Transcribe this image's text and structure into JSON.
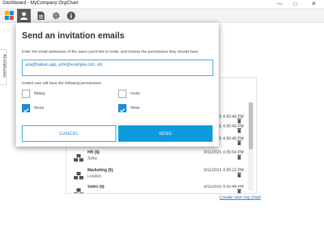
{
  "window": {
    "title": "Dashboard - MyCompany OrgChart",
    "controls": [
      "minimize-icon",
      "maximize-icon",
      "close-icon"
    ]
  },
  "toolbar": {
    "items": [
      {
        "icon": "app-logo-icon"
      },
      {
        "icon": "user-icon",
        "active": true
      },
      {
        "icon": "document-icon"
      },
      {
        "icon": "gear-icon"
      },
      {
        "icon": "info-icon"
      }
    ]
  },
  "sidetab": {
    "label": "All employees"
  },
  "dialog": {
    "title": "Send an invitation emails",
    "instructions": "Enter the email addresses of the users you'd like to invite, and choose the permissions they should have",
    "emails_placeholder": "ana@balkan.app, john@example.com, etc",
    "permissions_label": "Invited user will have the following permissions",
    "permissions": [
      {
        "label": "Billing",
        "checked": false
      },
      {
        "label": "Invite",
        "checked": false
      },
      {
        "label": "Read",
        "checked": true
      },
      {
        "label": "Write",
        "checked": true
      }
    ],
    "cancel_label": "CANCEL",
    "send_label": "SEND"
  },
  "list": {
    "visible_dates": [
      "3/11/2021 4:30:48 PM",
      "3/11/2021 4:30:48 PM",
      "3/11/2021 4:30:48 PM"
    ],
    "rows": [
      {
        "name": "HR ($)",
        "location": "Sofia",
        "date": "3/11/2021 4:35:54 PM"
      },
      {
        "name": "Marketing ($)",
        "location": "London",
        "date": "3/11/2021 4:35:22 PM"
      },
      {
        "name": "Sales ($)",
        "location": "",
        "date": "3/11/2021 4:35:48 PM"
      }
    ],
    "create_link": "Create new org chart"
  },
  "colors": {
    "accent": "#0e9bdc",
    "link": "#1a73c7",
    "icon_gray": "#555555",
    "toolbar_active": "#5a5a5a"
  }
}
